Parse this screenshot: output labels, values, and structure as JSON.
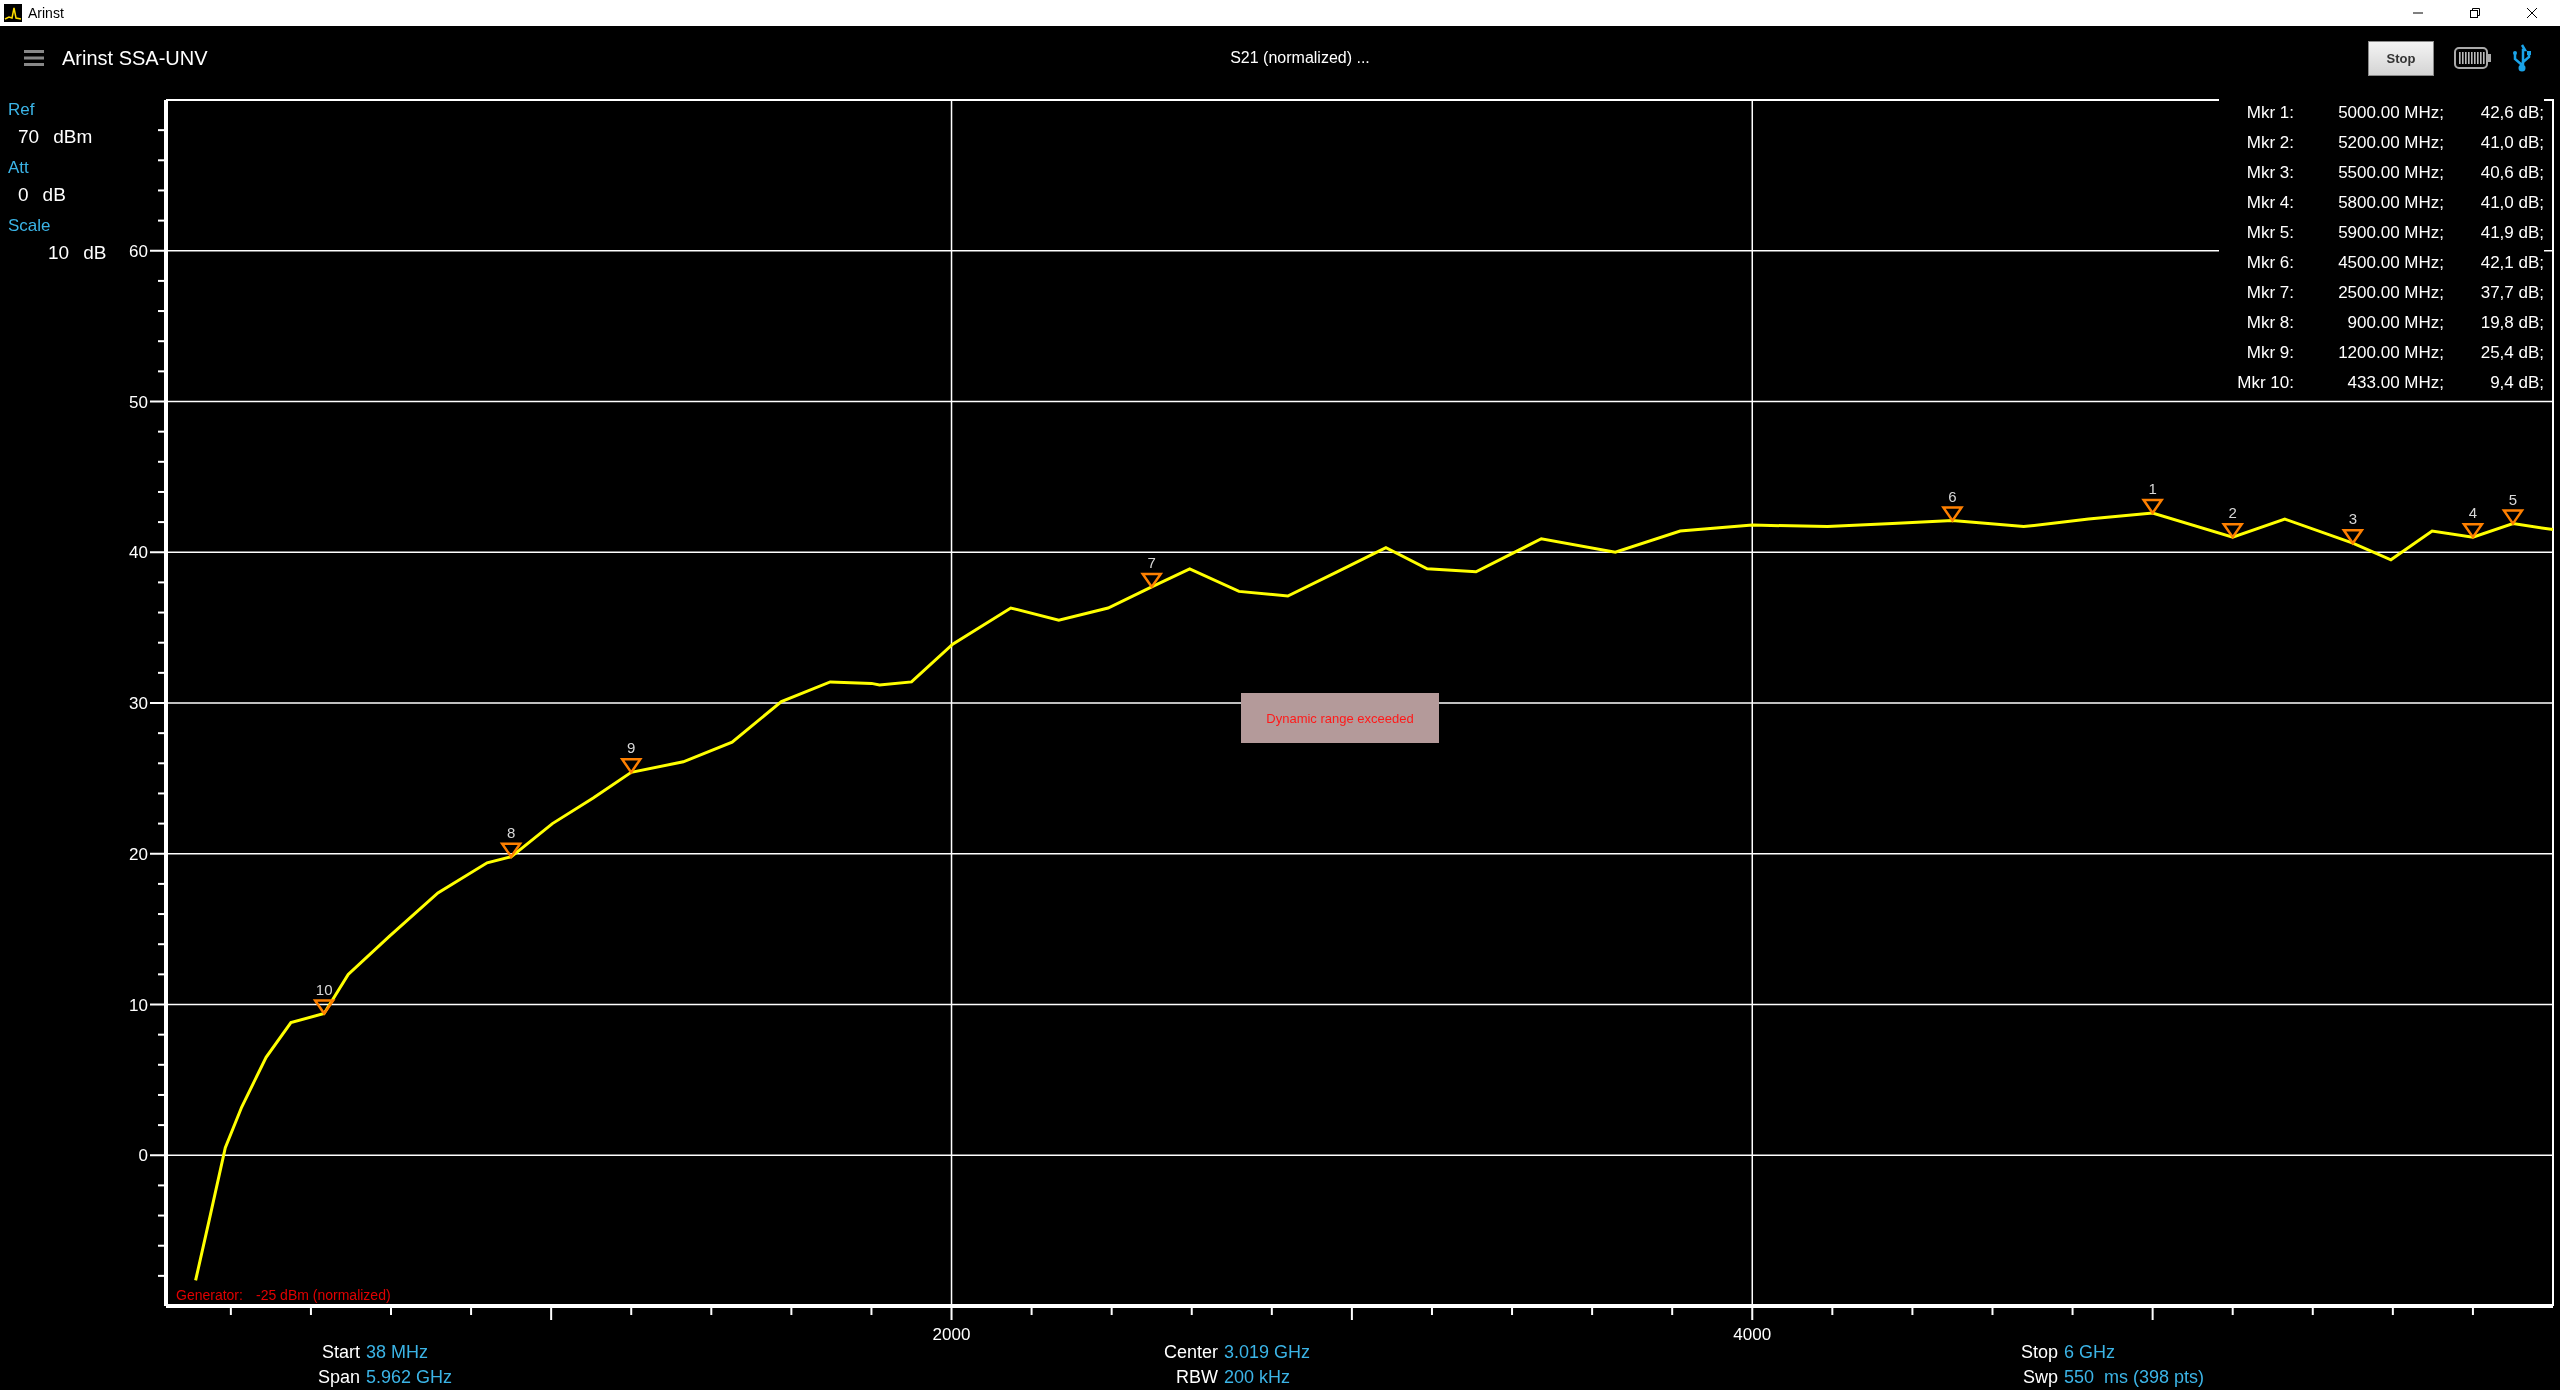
{
  "window": {
    "title": "Arinst"
  },
  "header": {
    "device": "Arinst SSA-UNV",
    "mode": "S21 (normalized) ...",
    "stop_button": "Stop"
  },
  "settings": [
    {
      "label": "Ref",
      "value": "70",
      "unit": "dBm"
    },
    {
      "label": "Att",
      "value": "0",
      "unit": "dB"
    },
    {
      "label": "Scale",
      "value": "10",
      "unit": "dB"
    }
  ],
  "markers_table": [
    {
      "name": "Mkr 1:",
      "frequency": "5000.00 MHz;",
      "value": "42,6 dB;"
    },
    {
      "name": "Mkr 2:",
      "frequency": "5200.00 MHz;",
      "value": "41,0 dB;"
    },
    {
      "name": "Mkr 3:",
      "frequency": "5500.00 MHz;",
      "value": "40,6 dB;"
    },
    {
      "name": "Mkr 4:",
      "frequency": "5800.00 MHz;",
      "value": "41,0 dB;"
    },
    {
      "name": "Mkr 5:",
      "frequency": "5900.00 MHz;",
      "value": "41,9 dB;"
    },
    {
      "name": "Mkr 6:",
      "frequency": "4500.00 MHz;",
      "value": "42,1 dB;"
    },
    {
      "name": "Mkr 7:",
      "frequency": "2500.00 MHz;",
      "value": "37,7 dB;"
    },
    {
      "name": "Mkr 8:",
      "frequency": "900.00 MHz;",
      "value": "19,8 dB;"
    },
    {
      "name": "Mkr 9:",
      "frequency": "1200.00 MHz;",
      "value": "25,4 dB;"
    },
    {
      "name": "Mkr 10:",
      "frequency": "433.00 MHz;",
      "value": "9,4 dB;"
    }
  ],
  "warning": "Dynamic range exceeded",
  "generator": {
    "label": "Generator:",
    "value": "-25 dBm (normalized)"
  },
  "chart_data": {
    "type": "line",
    "xlim": [
      38,
      6000
    ],
    "ylim": [
      -10,
      70
    ],
    "xticks": [
      2000,
      4000
    ],
    "yticks": [
      0,
      10,
      20,
      30,
      40,
      50,
      60
    ],
    "x": [
      112,
      146,
      186,
      227,
      288,
      350,
      433,
      493,
      595,
      717,
      840,
      900,
      1003,
      1105,
      1200,
      1330,
      1452,
      1575,
      1697,
      1800,
      1820,
      1900,
      2003,
      2148,
      2268,
      2391,
      2500,
      2595,
      2718,
      2840,
      2963,
      3085,
      3188,
      3310,
      3473,
      3658,
      3820,
      4000,
      4188,
      4350,
      4500,
      4678,
      4840,
      5000,
      5200,
      5330,
      5500,
      5595,
      5698,
      5800,
      5900,
      6000
    ],
    "series": [
      {
        "color": "#ffff00",
        "values": [
          -8.3,
          -4.3,
          0.5,
          3.2,
          6.5,
          8.8,
          9.4,
          12,
          14.5,
          17.4,
          19.4,
          19.8,
          22,
          23.7,
          25.4,
          26.1,
          27.4,
          30.1,
          31.4,
          31.3,
          31.2,
          31.4,
          33.9,
          36.3,
          35.5,
          36.3,
          37.7,
          38.9,
          37.4,
          37.1,
          38.7,
          40.3,
          38.9,
          38.7,
          40.9,
          40,
          41.4,
          41.8,
          41.7,
          41.9,
          42.1,
          41.7,
          42.2,
          42.6,
          41,
          42.2,
          40.6,
          39.5,
          41.4,
          41,
          41.9,
          41.5
        ]
      }
    ],
    "grid": true,
    "annotations": [
      {
        "x": 5000,
        "y": 42.6,
        "text": "1"
      },
      {
        "x": 5200,
        "y": 41.0,
        "text": "2"
      },
      {
        "x": 5500,
        "y": 40.6,
        "text": "3"
      },
      {
        "x": 5800,
        "y": 41.0,
        "text": "4"
      },
      {
        "x": 5900,
        "y": 41.9,
        "text": "5"
      },
      {
        "x": 4500,
        "y": 42.1,
        "text": "6"
      },
      {
        "x": 2500,
        "y": 37.7,
        "text": "7"
      },
      {
        "x": 900,
        "y": 19.8,
        "text": "8"
      },
      {
        "x": 1200,
        "y": 25.4,
        "text": "9"
      },
      {
        "x": 433,
        "y": 9.4,
        "text": "10"
      }
    ]
  },
  "footer": [
    {
      "rows": [
        {
          "label": "Start",
          "value": "38 MHz"
        },
        {
          "label": "Span",
          "value": "5.962 GHz"
        }
      ]
    },
    {
      "rows": [
        {
          "label": "Center",
          "value": "3.019 GHz"
        },
        {
          "label": "RBW",
          "value": "200 kHz"
        }
      ]
    },
    {
      "rows": [
        {
          "label": "Stop",
          "value": "6 GHz"
        },
        {
          "label": "Swp",
          "value": "550  ms (398 pts)"
        }
      ]
    }
  ]
}
